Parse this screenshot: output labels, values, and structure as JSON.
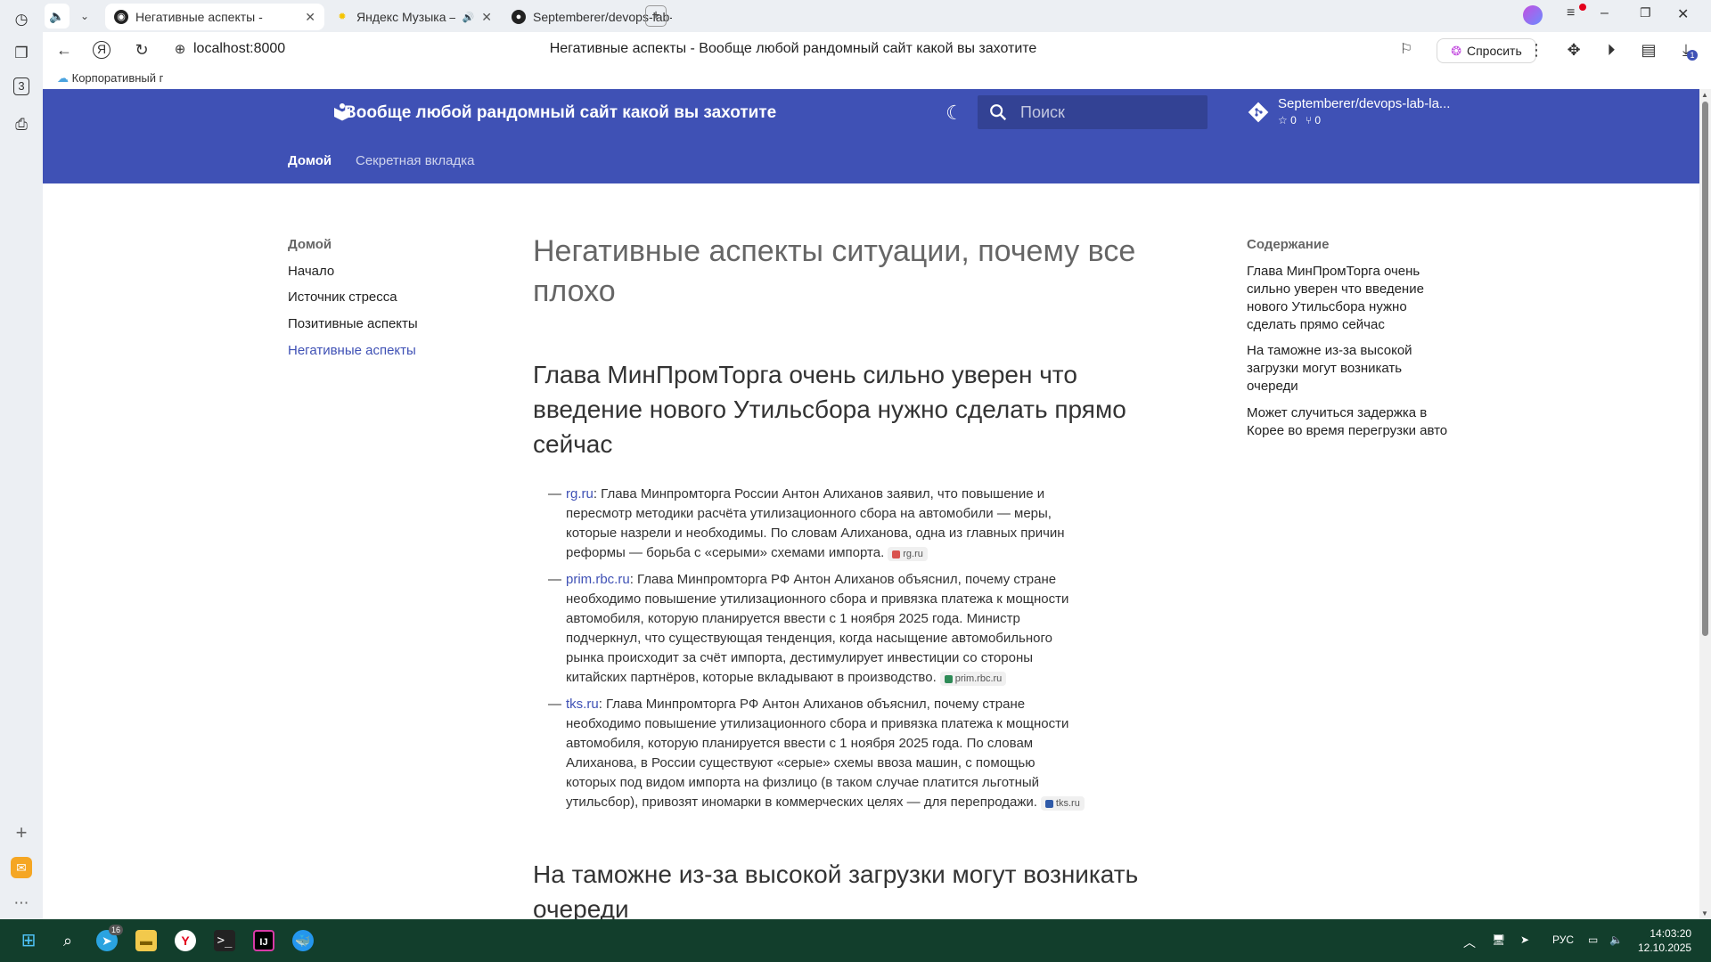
{
  "browser": {
    "tabs": [
      {
        "title": "Негативные аспекты - ",
        "active": true
      },
      {
        "title": "Яндекс Музыка — с",
        "active": false
      },
      {
        "title": "Septemberer/devops-lab-",
        "active": false
      }
    ],
    "url": "localhost:8000",
    "page_title": "Негативные аспекты - Вообще любой рандомный сайт какой вы захотите",
    "ask_label": "Спросить",
    "bookmark": "Корпоративный г",
    "rail_badge": "3",
    "downloads_badge": "1"
  },
  "site": {
    "title": "Вообще любой рандомный сайт какой вы захотите",
    "search_placeholder": "Поиск",
    "repo_name": "Septemberer/devops-lab-la...",
    "repo_stars": "0",
    "repo_forks": "0",
    "tabs": [
      "Домой",
      "Секретная вкладка"
    ]
  },
  "nav": {
    "title": "Домой",
    "items": [
      "Начало",
      "Источник стресса",
      "Позитивные аспекты",
      "Негативные аспекты"
    ],
    "current": "Негативные аспекты"
  },
  "content": {
    "page_title": "Негативные аспекты ситуации, почему все плохо",
    "section1_title": "Глава МинПромТорга очень сильно уверен что введение нового Утильсбора нужно сделать прямо сейчас",
    "quotes": [
      {
        "source": "rg.ru",
        "text": ": Глава Минпромторга России Антон Алиханов заявил, что повышение и пересмотр методики расчёта утилизационного сбора на автомобили — меры, которые назрели и необходимы. По словам Алиханова, одна из главных причин реформы — борьба с «серыми» схемами импорта.",
        "chip": "rg.ru"
      },
      {
        "source": "prim.rbc.ru",
        "text": ": Глава Минпромторга РФ Антон Алиханов объяснил, почему стране необходимо повышение утилизационного сбора и привязка платежа к мощности автомобиля, которую планируется ввести с 1 ноября 2025 года. Министр подчеркнул, что существующая тенденция, когда насыщение автомобильного рынка происходит за счёт импорта, дестимулирует инвестиции со стороны китайских партнёров, которые вкладывают в производство.",
        "chip": "prim.rbc.ru"
      },
      {
        "source": "tks.ru",
        "text": ": Глава Минпромторга РФ Антон Алиханов объяснил, почему стране необходимо повышение утилизационного сбора и привязка платежа к мощности автомобиля, которую планируется ввести с 1 ноября 2025 года. По словам Алиханова, в России существуют «серые» схемы ввоза машин, с помощью которых под видом импорта на физлицо (в таком случае платится льготный утильсбор), привозят иномарки в коммерческих целях — для перепродажи.",
        "chip": "tks.ru"
      }
    ],
    "section2_title": "На таможне из-за высокой загрузки могут возникать очереди"
  },
  "toc": {
    "title": "Содержание",
    "items": [
      "Глава МинПромТорга очень сильно уверен что введение нового Утильсбора нужно сделать прямо сейчас",
      "На таможне из-за высокой загрузки могут возникать очереди",
      "Может случиться задержка в Корее во время перегрузки авто"
    ]
  },
  "taskbar": {
    "telegram_badge": "16",
    "lang": "РУС",
    "time": "14:03:20",
    "date": "12.10.2025"
  },
  "colors": {
    "primary": "#3f51b5",
    "taskbar": "#123e2c"
  }
}
